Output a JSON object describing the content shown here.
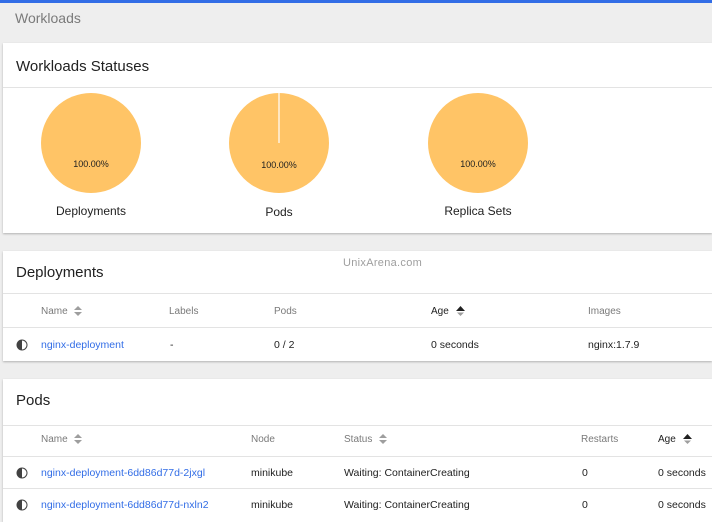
{
  "page": {
    "title": "Workloads"
  },
  "watermark": "UnixArena.com",
  "colors": {
    "pie": "#ffc466",
    "link": "#326de6",
    "accent": "#326de6"
  },
  "statuses": {
    "title": "Workloads Statuses",
    "charts": [
      {
        "label": "Deployments",
        "percent": "100.00%",
        "value": 100
      },
      {
        "label": "Pods",
        "percent": "100.00%",
        "value": 100
      },
      {
        "label": "Replica Sets",
        "percent": "100.00%",
        "value": 100
      }
    ]
  },
  "deployments": {
    "title": "Deployments",
    "headers": {
      "name": "Name",
      "labels": "Labels",
      "pods": "Pods",
      "age": "Age",
      "images": "Images"
    },
    "rows": [
      {
        "name": "nginx-deployment",
        "labels": "-",
        "pods": "0 / 2",
        "age": "0 seconds",
        "images": "nginx:1.7.9"
      }
    ]
  },
  "pods": {
    "title": "Pods",
    "headers": {
      "name": "Name",
      "node": "Node",
      "status": "Status",
      "restarts": "Restarts",
      "age": "Age"
    },
    "rows": [
      {
        "name": "nginx-deployment-6dd86d77d-2jxgl",
        "node": "minikube",
        "status": "Waiting: ContainerCreating",
        "restarts": "0",
        "age": "0 seconds"
      },
      {
        "name": "nginx-deployment-6dd86d77d-nxln2",
        "node": "minikube",
        "status": "Waiting: ContainerCreating",
        "restarts": "0",
        "age": "0 seconds"
      }
    ]
  }
}
